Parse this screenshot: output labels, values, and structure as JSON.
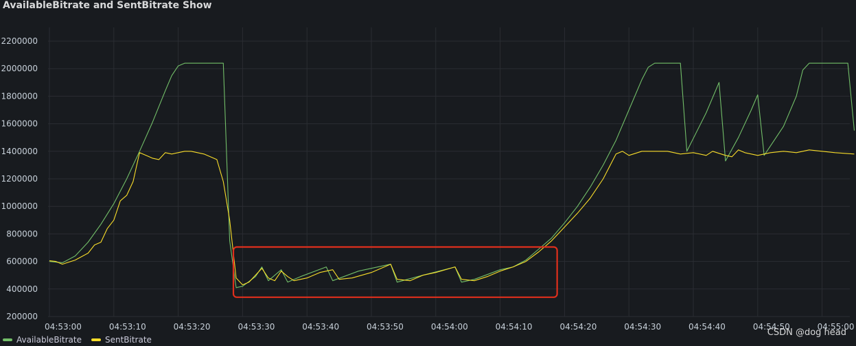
{
  "panel": {
    "title": "AvailableBitrate and SentBitrate Show",
    "watermark": "CSDN @dog head"
  },
  "colors": {
    "background": "#181b1f",
    "grid": "#2a2d33",
    "available": "#73bf69",
    "sent": "#fade2a",
    "highlight_box": "#e02f1c"
  },
  "highlight": {
    "x_range": [
      "04:53:29",
      "04:54:18"
    ],
    "y_range": [
      380000,
      710000
    ]
  },
  "chart_data": {
    "type": "line",
    "title": "AvailableBitrate and SentBitrate Show",
    "xlabel": "",
    "ylabel": "",
    "x_ticks": [
      "04:53:00",
      "04:53:10",
      "04:53:20",
      "04:53:30",
      "04:53:40",
      "04:53:50",
      "04:54:00",
      "04:54:10",
      "04:54:20",
      "04:54:30",
      "04:54:40",
      "04:54:50",
      "04:55:00"
    ],
    "y_ticks": [
      "200000",
      "400000",
      "600000",
      "800000",
      "1000000",
      "1200000",
      "1400000",
      "1600000",
      "1800000",
      "2000000",
      "2200000"
    ],
    "ylim": [
      200000,
      2200000
    ],
    "grid": true,
    "legend_position": "bottom-left",
    "series": [
      {
        "name": "AvailableBitrate",
        "color": "#73bf69",
        "points": [
          [
            "04:53:00",
            600000
          ],
          [
            "04:53:02",
            590000
          ],
          [
            "04:53:04",
            640000
          ],
          [
            "04:53:06",
            740000
          ],
          [
            "04:53:08",
            870000
          ],
          [
            "04:53:10",
            1020000
          ],
          [
            "04:53:12",
            1200000
          ],
          [
            "04:53:14",
            1400000
          ],
          [
            "04:53:16",
            1610000
          ],
          [
            "04:53:18",
            1840000
          ],
          [
            "04:53:19",
            1950000
          ],
          [
            "04:53:20",
            2020000
          ],
          [
            "04:53:21",
            2040000
          ],
          [
            "04:53:22",
            2040000
          ],
          [
            "04:53:27",
            2040000
          ],
          [
            "04:53:28",
            750000
          ],
          [
            "04:53:29",
            410000
          ],
          [
            "04:53:30",
            420000
          ],
          [
            "04:53:32",
            490000
          ],
          [
            "04:53:33",
            560000
          ],
          [
            "04:53:34",
            460000
          ],
          [
            "04:53:36",
            540000
          ],
          [
            "04:53:37",
            450000
          ],
          [
            "04:53:39",
            490000
          ],
          [
            "04:53:43",
            560000
          ],
          [
            "04:53:44",
            460000
          ],
          [
            "04:53:48",
            530000
          ],
          [
            "04:53:53",
            580000
          ],
          [
            "04:53:54",
            450000
          ],
          [
            "04:53:58",
            500000
          ],
          [
            "04:54:03",
            560000
          ],
          [
            "04:54:04",
            450000
          ],
          [
            "04:54:06",
            470000
          ],
          [
            "04:54:10",
            540000
          ],
          [
            "04:54:12",
            560000
          ],
          [
            "04:54:14",
            610000
          ],
          [
            "04:54:16",
            690000
          ],
          [
            "04:54:18",
            770000
          ],
          [
            "04:54:20",
            880000
          ],
          [
            "04:54:22",
            1000000
          ],
          [
            "04:54:24",
            1140000
          ],
          [
            "04:54:26",
            1300000
          ],
          [
            "04:54:28",
            1480000
          ],
          [
            "04:54:30",
            1700000
          ],
          [
            "04:54:32",
            1920000
          ],
          [
            "04:54:33",
            2010000
          ],
          [
            "04:54:34",
            2040000
          ],
          [
            "04:54:38",
            2040000
          ],
          [
            "04:54:39",
            1400000
          ],
          [
            "04:54:42",
            1680000
          ],
          [
            "04:54:44",
            1900000
          ],
          [
            "04:54:45",
            1330000
          ],
          [
            "04:54:47",
            1500000
          ],
          [
            "04:54:49",
            1700000
          ],
          [
            "04:54:50",
            1810000
          ],
          [
            "04:54:51",
            1370000
          ],
          [
            "04:54:54",
            1580000
          ],
          [
            "04:54:56",
            1800000
          ],
          [
            "04:54:57",
            1990000
          ],
          [
            "04:54:58",
            2040000
          ],
          [
            "04:55:04",
            2040000
          ],
          [
            "04:55:05",
            1550000
          ]
        ]
      },
      {
        "name": "SentBitrate",
        "color": "#fade2a",
        "points": [
          [
            "04:53:00",
            605000
          ],
          [
            "04:53:01",
            600000
          ],
          [
            "04:53:02",
            580000
          ],
          [
            "04:53:04",
            610000
          ],
          [
            "04:53:06",
            660000
          ],
          [
            "04:53:07",
            720000
          ],
          [
            "04:53:08",
            740000
          ],
          [
            "04:53:09",
            840000
          ],
          [
            "04:53:10",
            900000
          ],
          [
            "04:53:11",
            1040000
          ],
          [
            "04:53:12",
            1080000
          ],
          [
            "04:53:13",
            1180000
          ],
          [
            "04:53:14",
            1390000
          ],
          [
            "04:53:15",
            1370000
          ],
          [
            "04:53:16",
            1350000
          ],
          [
            "04:53:17",
            1340000
          ],
          [
            "04:53:18",
            1390000
          ],
          [
            "04:53:19",
            1380000
          ],
          [
            "04:53:20",
            1390000
          ],
          [
            "04:53:21",
            1400000
          ],
          [
            "04:53:22",
            1400000
          ],
          [
            "04:53:24",
            1380000
          ],
          [
            "04:53:26",
            1340000
          ],
          [
            "04:53:27",
            1180000
          ],
          [
            "04:53:28",
            900000
          ],
          [
            "04:53:29",
            480000
          ],
          [
            "04:53:30",
            430000
          ],
          [
            "04:53:31",
            450000
          ],
          [
            "04:53:33",
            550000
          ],
          [
            "04:53:34",
            480000
          ],
          [
            "04:53:35",
            460000
          ],
          [
            "04:53:36",
            530000
          ],
          [
            "04:53:37",
            490000
          ],
          [
            "04:53:38",
            460000
          ],
          [
            "04:53:40",
            480000
          ],
          [
            "04:53:42",
            520000
          ],
          [
            "04:53:44",
            540000
          ],
          [
            "04:53:45",
            470000
          ],
          [
            "04:53:47",
            480000
          ],
          [
            "04:53:50",
            520000
          ],
          [
            "04:53:53",
            580000
          ],
          [
            "04:53:54",
            470000
          ],
          [
            "04:53:56",
            460000
          ],
          [
            "04:53:58",
            500000
          ],
          [
            "04:54:00",
            520000
          ],
          [
            "04:54:03",
            560000
          ],
          [
            "04:54:04",
            470000
          ],
          [
            "04:54:06",
            460000
          ],
          [
            "04:54:08",
            490000
          ],
          [
            "04:54:10",
            530000
          ],
          [
            "04:54:12",
            560000
          ],
          [
            "04:54:14",
            600000
          ],
          [
            "04:54:16",
            670000
          ],
          [
            "04:54:18",
            750000
          ],
          [
            "04:54:20",
            850000
          ],
          [
            "04:54:22",
            950000
          ],
          [
            "04:54:24",
            1060000
          ],
          [
            "04:54:26",
            1200000
          ],
          [
            "04:54:28",
            1380000
          ],
          [
            "04:54:29",
            1400000
          ],
          [
            "04:54:30",
            1370000
          ],
          [
            "04:54:32",
            1400000
          ],
          [
            "04:54:36",
            1400000
          ],
          [
            "04:54:38",
            1380000
          ],
          [
            "04:54:40",
            1390000
          ],
          [
            "04:54:42",
            1370000
          ],
          [
            "04:54:43",
            1400000
          ],
          [
            "04:54:45",
            1370000
          ],
          [
            "04:54:46",
            1360000
          ],
          [
            "04:54:47",
            1410000
          ],
          [
            "04:54:48",
            1390000
          ],
          [
            "04:54:50",
            1370000
          ],
          [
            "04:54:52",
            1390000
          ],
          [
            "04:54:54",
            1400000
          ],
          [
            "04:54:56",
            1390000
          ],
          [
            "04:54:58",
            1410000
          ],
          [
            "04:55:00",
            1400000
          ],
          [
            "04:55:02",
            1390000
          ],
          [
            "04:55:05",
            1380000
          ]
        ]
      }
    ]
  }
}
